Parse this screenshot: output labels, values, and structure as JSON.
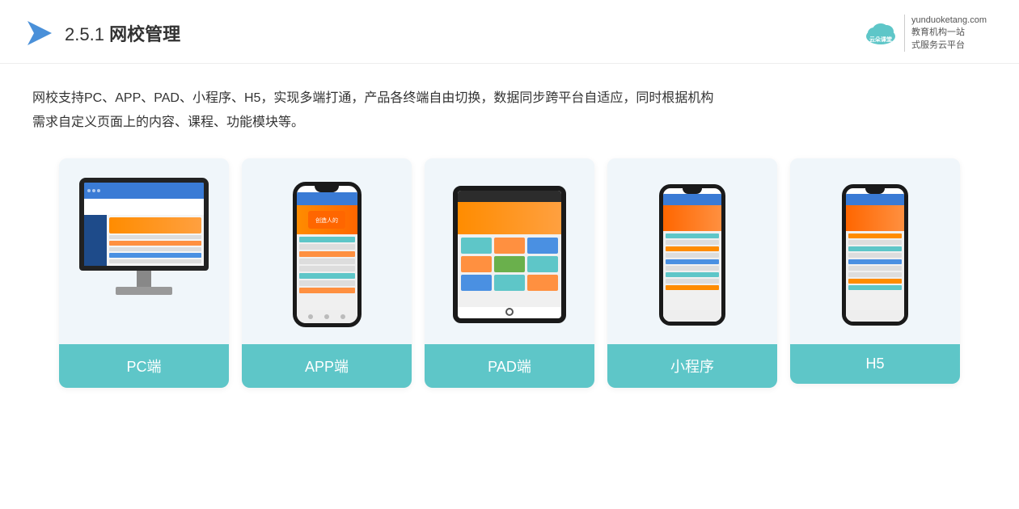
{
  "header": {
    "section_number": "2.5.1",
    "title_plain": "网校管理",
    "brand_url": "yunduoketang.com",
    "brand_tagline_1": "教育机构一站",
    "brand_tagline_2": "式服务云平台"
  },
  "description": {
    "line1": "网校支持PC、APP、PAD、小程序、H5，实现多端打通，产品各终端自由切换，数据同步跨平台自适应，同时根据机构",
    "line2": "需求自定义页面上的内容、课程、功能模块等。"
  },
  "cards": [
    {
      "id": "pc",
      "label": "PC端"
    },
    {
      "id": "app",
      "label": "APP端"
    },
    {
      "id": "pad",
      "label": "PAD端"
    },
    {
      "id": "miniapp",
      "label": "小程序"
    },
    {
      "id": "h5",
      "label": "H5"
    }
  ]
}
